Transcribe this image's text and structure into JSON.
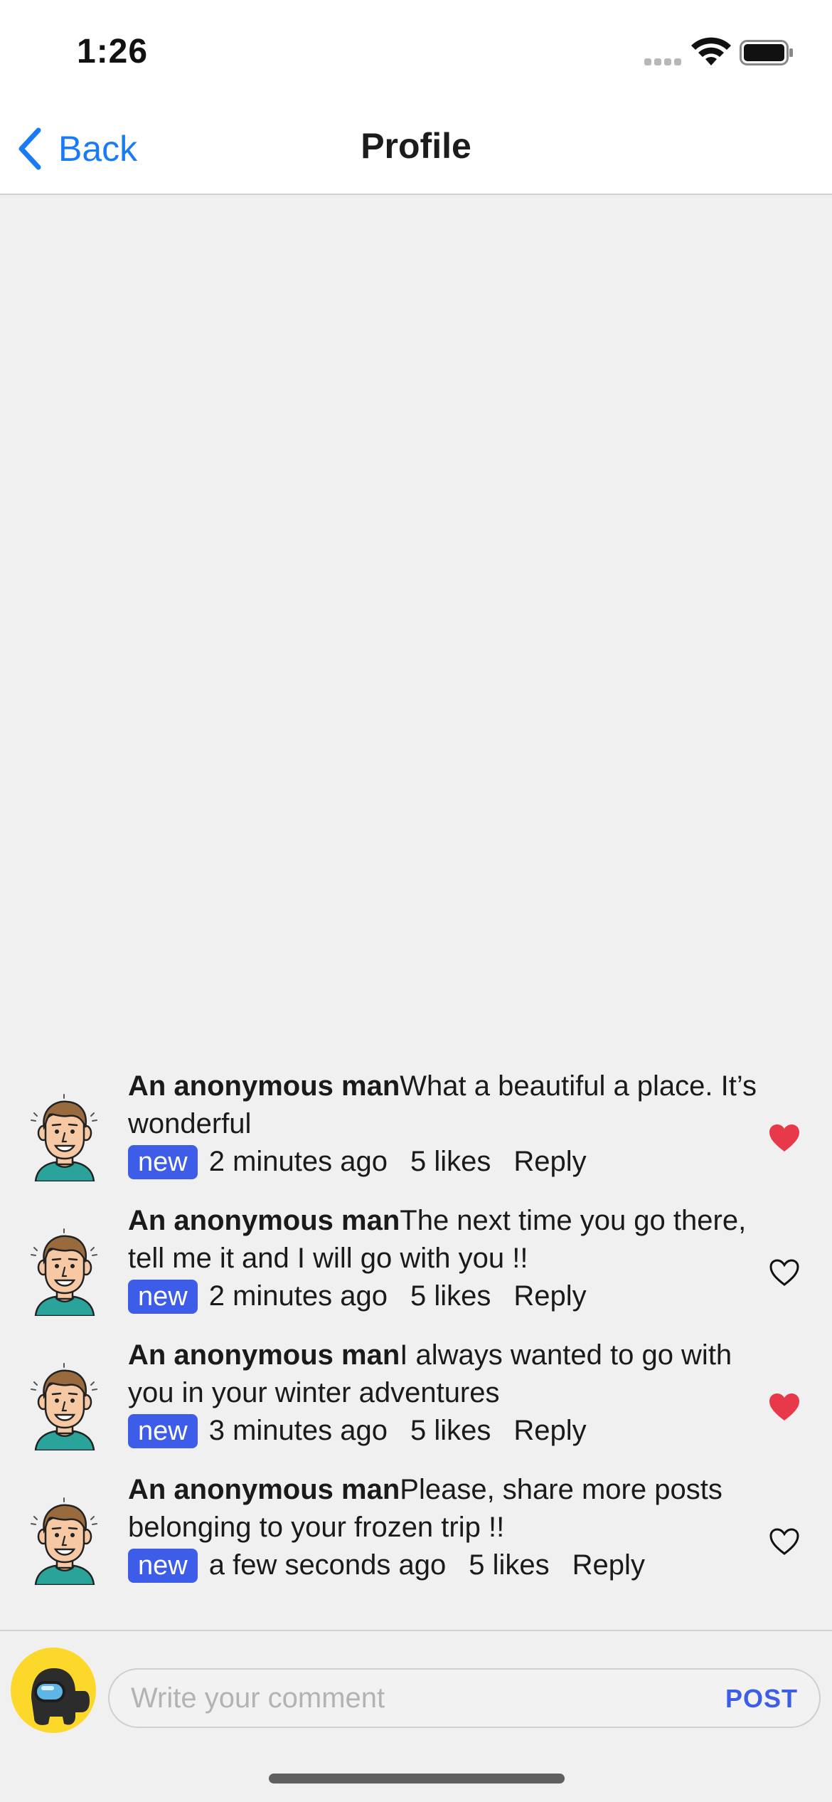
{
  "status_bar": {
    "time": "1:26"
  },
  "nav": {
    "back_label": "Back",
    "title": "Profile"
  },
  "comments": [
    {
      "author": "An anonymous man",
      "text": "What a beautiful a place. It’s wonderful",
      "badge": "new",
      "time": "2 minutes ago",
      "likes": "5 likes",
      "reply": "Reply",
      "liked": true
    },
    {
      "author": "An anonymous man",
      "text": "The next time you go there, tell me it and I will go with you !!",
      "badge": "new",
      "time": "2 minutes ago",
      "likes": "5 likes",
      "reply": "Reply",
      "liked": false
    },
    {
      "author": "An anonymous man",
      "text": "I always wanted to go with you in your winter adventures",
      "badge": "new",
      "time": "3 minutes ago",
      "likes": "5 likes",
      "reply": "Reply",
      "liked": true
    },
    {
      "author": "An anonymous man",
      "text": "Please, share more posts belonging to your frozen trip !!",
      "badge": "new",
      "time": "a few seconds ago",
      "likes": "5 likes",
      "reply": "Reply",
      "liked": false
    }
  ],
  "compose": {
    "placeholder": "Write your comment",
    "post_label": "POST"
  },
  "colors": {
    "accent": "#3d5ce8",
    "link": "#1a7cf5",
    "heart_liked": "#e8394b"
  }
}
